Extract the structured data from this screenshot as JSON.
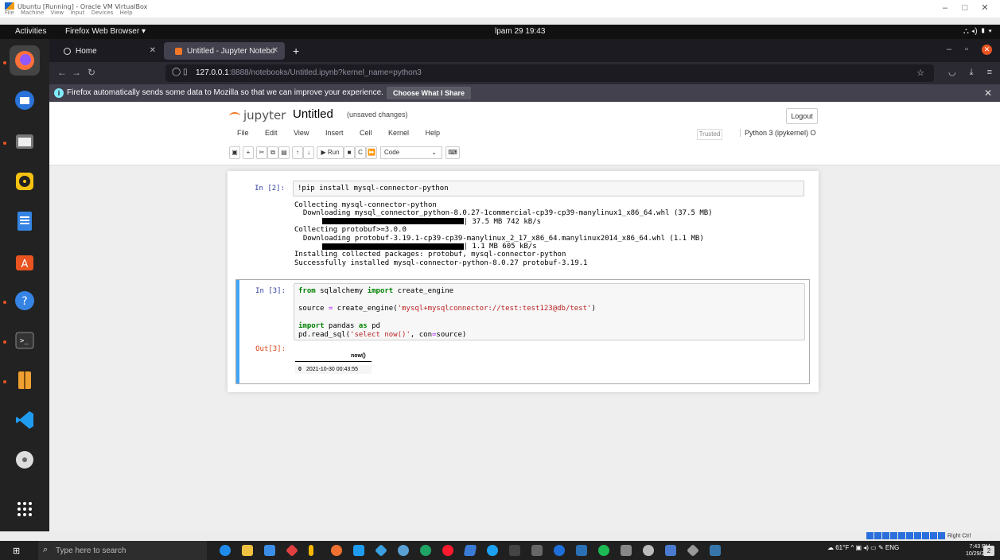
{
  "vbox": {
    "title": "Ubuntu [Running] - Oracle VM VirtualBox",
    "menu": [
      "File",
      "Machine",
      "View",
      "Input",
      "Devices",
      "Help"
    ],
    "minimize": "–",
    "maximize": "□",
    "close": "✕"
  },
  "gnome": {
    "activities": "Activities",
    "app": "Firefox Web Browser ▾",
    "clock": "lpam 29  19:43",
    "tray": "⛬  ◂)  ▮ ▾"
  },
  "firefox": {
    "tabs": [
      {
        "label": "Home"
      },
      {
        "label": "Untitled - Jupyter Notebo"
      }
    ],
    "url_host": "127.0.0.1",
    "url_rest": ":8888/notebooks/Untitled.ipynb?kernel_name=python3",
    "notice": "Firefox automatically sends some data to Mozilla so that we can improve your experience.",
    "notice_button": "Choose What I Share"
  },
  "jupyter": {
    "logo": "jupyter",
    "notebook_name": "Untitled",
    "save_status": "(unsaved changes)",
    "logout": "Logout",
    "menu": [
      "File",
      "Edit",
      "View",
      "Insert",
      "Cell",
      "Kernel",
      "Help"
    ],
    "trusted": "Trusted",
    "kernel": "Python 3 (ipykernel)  O",
    "toolbar": {
      "run": "▶ Run",
      "cell_type": "Code"
    },
    "cells": {
      "c2": {
        "prompt": "In [2]:",
        "code": "!pip install mysql-connector-python",
        "output": [
          "Collecting mysql-connector-python",
          "  Downloading mysql_connector_python-8.0.27-1commercial-cp39-cp39-manylinux1_x86_64.whl (37.5 MB)",
          "| 37.5 MB 742 kB/s",
          "Collecting protobuf>=3.0.0",
          "  Downloading protobuf-3.19.1-cp39-cp39-manylinux_2_17_x86_64.manylinux2014_x86_64.whl (1.1 MB)",
          "| 1.1 MB 605 kB/s",
          "Installing collected packages: protobuf, mysql-connector-python",
          "Successfully installed mysql-connector-python-8.0.27 protobuf-3.19.1"
        ]
      },
      "c3": {
        "prompt": "In [3]:",
        "line1_kw": "from",
        "line1_a": " sqlalchemy ",
        "line1_kw2": "import",
        "line1_b": " create_engine",
        "line2_a": "source ",
        "line2_op": "=",
        "line2_b": " create_engine(",
        "line2_str": "'mysql+mysqlconnector://test:test123@db/test'",
        "line2_c": ")",
        "line3_kw": "import",
        "line3_a": " pandas ",
        "line3_kw2": "as",
        "line3_b": " pd",
        "line4_a": "pd.read_sql(",
        "line4_str": "'select now()'",
        "line4_b": ", con",
        "line4_op": "=",
        "line4_c": "source)",
        "out_prompt": "Out[3]:",
        "df_header": "now()",
        "df_index": "0",
        "df_value": "2021-10-30 00:43:55"
      }
    }
  },
  "guest_tray_label": "Right Ctrl",
  "taskbar": {
    "search_placeholder": "Type here to search",
    "weather": "61°F",
    "lang": "ENG",
    "time": "7:43 PM",
    "date": "10/29/2021",
    "notif_count": "2"
  }
}
